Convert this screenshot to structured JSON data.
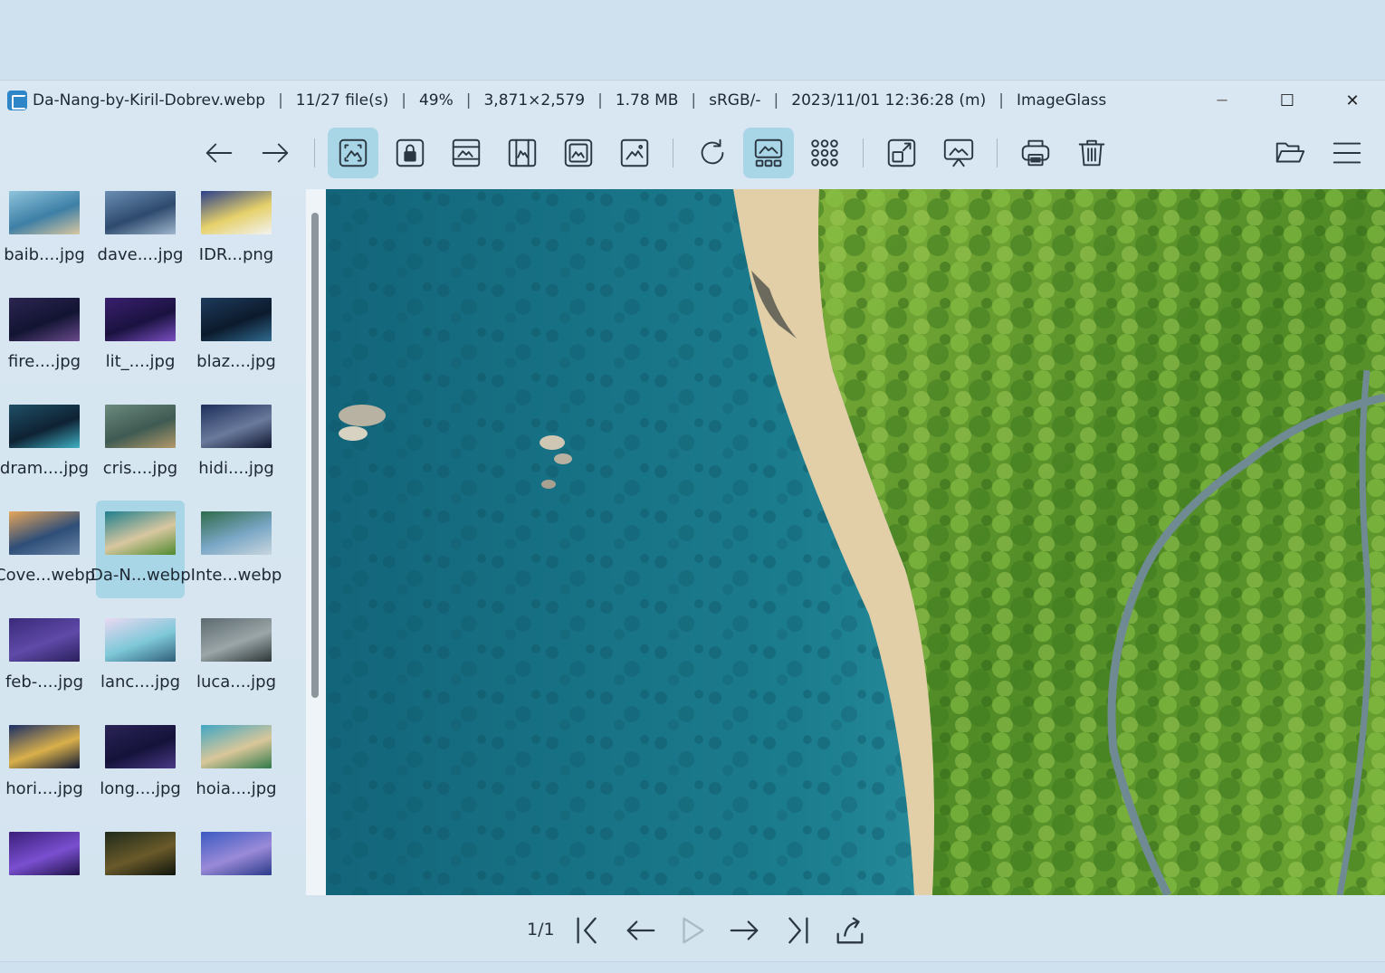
{
  "titlebar": {
    "filename": "Da-Nang-by-Kiril-Dobrev.webp",
    "file_index": "11/27 file(s)",
    "zoom": "49%",
    "dimensions": "3,871×2,579",
    "file_size": "1.78 MB",
    "color_profile": "sRGB/-",
    "date": "2023/11/01 12:36:28 (m)",
    "app_name": "ImageGlass",
    "separator": "|",
    "minimize": "─",
    "maximize": "☐",
    "close": "✕"
  },
  "toolbar": {
    "items": [
      {
        "name": "previous-image-button",
        "icon": "arrow-left-icon",
        "active": false
      },
      {
        "name": "next-image-button",
        "icon": "arrow-right-icon",
        "active": false
      },
      {
        "name": "auto-zoom-button",
        "icon": "auto-zoom-icon",
        "active": true
      },
      {
        "name": "lock-zoom-button",
        "icon": "lock-zoom-icon",
        "active": false
      },
      {
        "name": "scale-to-width-button",
        "icon": "scale-width-icon",
        "active": false
      },
      {
        "name": "scale-to-height-button",
        "icon": "scale-height-icon",
        "active": false
      },
      {
        "name": "scale-to-fit-button",
        "icon": "scale-fit-icon",
        "active": false
      },
      {
        "name": "scale-to-fill-button",
        "icon": "scale-fill-icon",
        "active": false
      },
      {
        "name": "refresh-button",
        "icon": "refresh-icon",
        "active": false
      },
      {
        "name": "gallery-toggle-button",
        "icon": "gallery-icon",
        "active": true
      },
      {
        "name": "checkerboard-button",
        "icon": "grid-dots-icon",
        "active": false
      },
      {
        "name": "fullscreen-button",
        "icon": "fullscreen-icon",
        "active": false
      },
      {
        "name": "slideshow-button",
        "icon": "slideshow-icon",
        "active": false
      },
      {
        "name": "print-button",
        "icon": "print-icon",
        "active": false
      },
      {
        "name": "delete-button",
        "icon": "trash-icon",
        "active": false
      },
      {
        "name": "open-file-button",
        "icon": "folder-open-icon",
        "active": false
      },
      {
        "name": "main-menu-button",
        "icon": "hamburger-menu-icon",
        "active": false
      }
    ]
  },
  "gallery": {
    "thumbnails": [
      {
        "label": "baib....jpg",
        "colors": [
          "#8fc4dc",
          "#3d7fa6",
          "#d9c7a1"
        ]
      },
      {
        "label": "dave....jpg",
        "colors": [
          "#6b8fb4",
          "#2e4a6e",
          "#9fb6cc"
        ]
      },
      {
        "label": "IDR...png",
        "colors": [
          "#2a3f8a",
          "#e6d16a",
          "#f2f2f2"
        ]
      },
      {
        "label": "fire....jpg",
        "colors": [
          "#2b2550",
          "#121433",
          "#6a4a8c"
        ]
      },
      {
        "label": "lit_....jpg",
        "colors": [
          "#3a1f6e",
          "#1a1240",
          "#7a4fc2"
        ]
      },
      {
        "label": "blaz....jpg",
        "colors": [
          "#1e3b5c",
          "#0c1a2c",
          "#2f6a8f"
        ]
      },
      {
        "label": "dram....jpg",
        "colors": [
          "#1f4f66",
          "#0e2233",
          "#3fb0c4"
        ]
      },
      {
        "label": "cris....jpg",
        "colors": [
          "#6d8a7e",
          "#3e5a52",
          "#b39a6a"
        ]
      },
      {
        "label": "hidi....jpg",
        "colors": [
          "#1d2e5a",
          "#6a7a9c",
          "#0f1630"
        ]
      },
      {
        "label": "Cove...webp",
        "colors": [
          "#e6a65a",
          "#2e4e78",
          "#6b86a8"
        ]
      },
      {
        "label": "Da-N...webp",
        "colors": [
          "#1e7f8d",
          "#d8c7a0",
          "#4f8a2f"
        ],
        "selected": true
      },
      {
        "label": "Inte...webp",
        "colors": [
          "#2f6a4a",
          "#7aa7c6",
          "#c9d6de"
        ]
      },
      {
        "label": "feb-....jpg",
        "colors": [
          "#3a2a7a",
          "#5f4aa8",
          "#2a1f5c"
        ]
      },
      {
        "label": "lanc....jpg",
        "colors": [
          "#e9d9f2",
          "#7ec8d8",
          "#2f5f7a"
        ]
      },
      {
        "label": "luca....jpg",
        "colors": [
          "#5d6a6e",
          "#9aa6a8",
          "#2c3536"
        ]
      },
      {
        "label": "hori....jpg",
        "colors": [
          "#1a2e66",
          "#d9b04a",
          "#0e1633"
        ]
      },
      {
        "label": "long....jpg",
        "colors": [
          "#2a2456",
          "#14123a",
          "#4a3a86"
        ]
      },
      {
        "label": "hoia....jpg",
        "colors": [
          "#3fa6c4",
          "#d9c79a",
          "#2f7a4a"
        ]
      },
      {
        "label": "",
        "colors": [
          "#3a1f7a",
          "#7a4fd0",
          "#1f1248"
        ]
      },
      {
        "label": "",
        "colors": [
          "#1f2a1a",
          "#6a5a2a",
          "#0e140c"
        ]
      },
      {
        "label": "",
        "colors": [
          "#3a5ac2",
          "#9a8ad8",
          "#2a3a8a"
        ]
      }
    ]
  },
  "bottombar": {
    "page": "1/1",
    "buttons": [
      {
        "name": "first-page-button",
        "icon": "skip-first-icon",
        "disabled": false
      },
      {
        "name": "previous-page-button",
        "icon": "arrow-left-icon",
        "disabled": false
      },
      {
        "name": "play-button",
        "icon": "play-icon",
        "disabled": true
      },
      {
        "name": "next-page-button",
        "icon": "arrow-right-icon",
        "disabled": false
      },
      {
        "name": "last-page-button",
        "icon": "skip-last-icon",
        "disabled": false
      },
      {
        "name": "export-page-button",
        "icon": "export-icon",
        "disabled": false
      }
    ]
  },
  "colors": {
    "window_bg": "#d4e4ef",
    "active_bg": "#a9d6e6",
    "sea_deep": "#13657a",
    "sea_shallow": "#3fa8b8",
    "sand": "#e2cfa8",
    "forest": "#5e9a2c"
  }
}
